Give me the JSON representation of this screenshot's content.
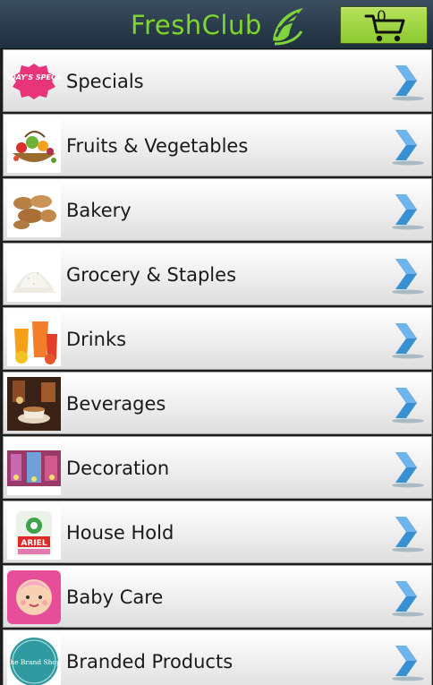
{
  "header": {
    "brand": "FreshClub",
    "brand_color": "#7fd43a",
    "cart_count": "0",
    "cart_accent": "#9fd544"
  },
  "categories": [
    {
      "label": "Specials",
      "thumb_text": "TODAY'S SPECIAL"
    },
    {
      "label": "Fruits & Vegetables"
    },
    {
      "label": "Bakery"
    },
    {
      "label": "Grocery & Staples"
    },
    {
      "label": "Drinks"
    },
    {
      "label": "Beverages"
    },
    {
      "label": "Decoration"
    },
    {
      "label": "House Hold",
      "thumb_text": "ARIEL"
    },
    {
      "label": "Baby Care"
    },
    {
      "label": "Branded Products",
      "thumb_text": "the Brand Shop"
    }
  ]
}
